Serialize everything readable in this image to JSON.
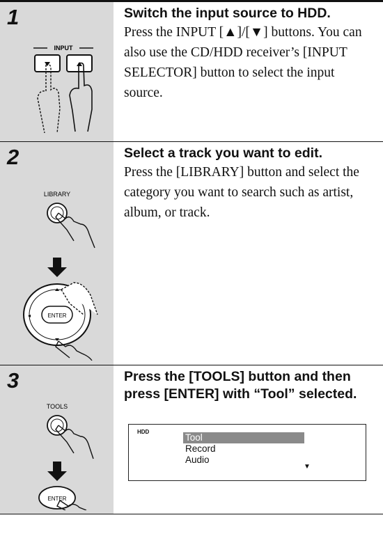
{
  "steps": [
    {
      "number": "1",
      "title": "Switch the input source to HDD.",
      "body": "Press the INPUT [▲]/[▼] buttons. You can also use the CD/HDD receiver’s [INPUT SELECTOR] button to select the input source.",
      "illustration": {
        "label": "INPUT",
        "icons": [
          "input-down-button",
          "input-up-button",
          "pointing-hand-icon"
        ]
      }
    },
    {
      "number": "2",
      "title": "Select a track you want to edit.",
      "body": "Press the [LIBRARY] button and select the category you want to search such as artist, album, or track.",
      "illustration": {
        "button_label": "LIBRARY",
        "pad_center_label": "ENTER",
        "icons": [
          "pointing-hand-icon",
          "down-arrow-icon",
          "direction-pad"
        ]
      }
    },
    {
      "number": "3",
      "title": "Press the [TOOLS] button and then press [ENTER] with “Tool” selected.",
      "illustration": {
        "button_label": "TOOLS",
        "enter_label": "ENTER",
        "icons": [
          "pointing-hand-icon",
          "down-arrow-icon"
        ]
      },
      "display": {
        "source": "HDD",
        "items": [
          "Tool",
          "Record",
          "Audio"
        ],
        "selected_index": 0,
        "scroll_indicator": "more-below-arrow"
      }
    }
  ]
}
